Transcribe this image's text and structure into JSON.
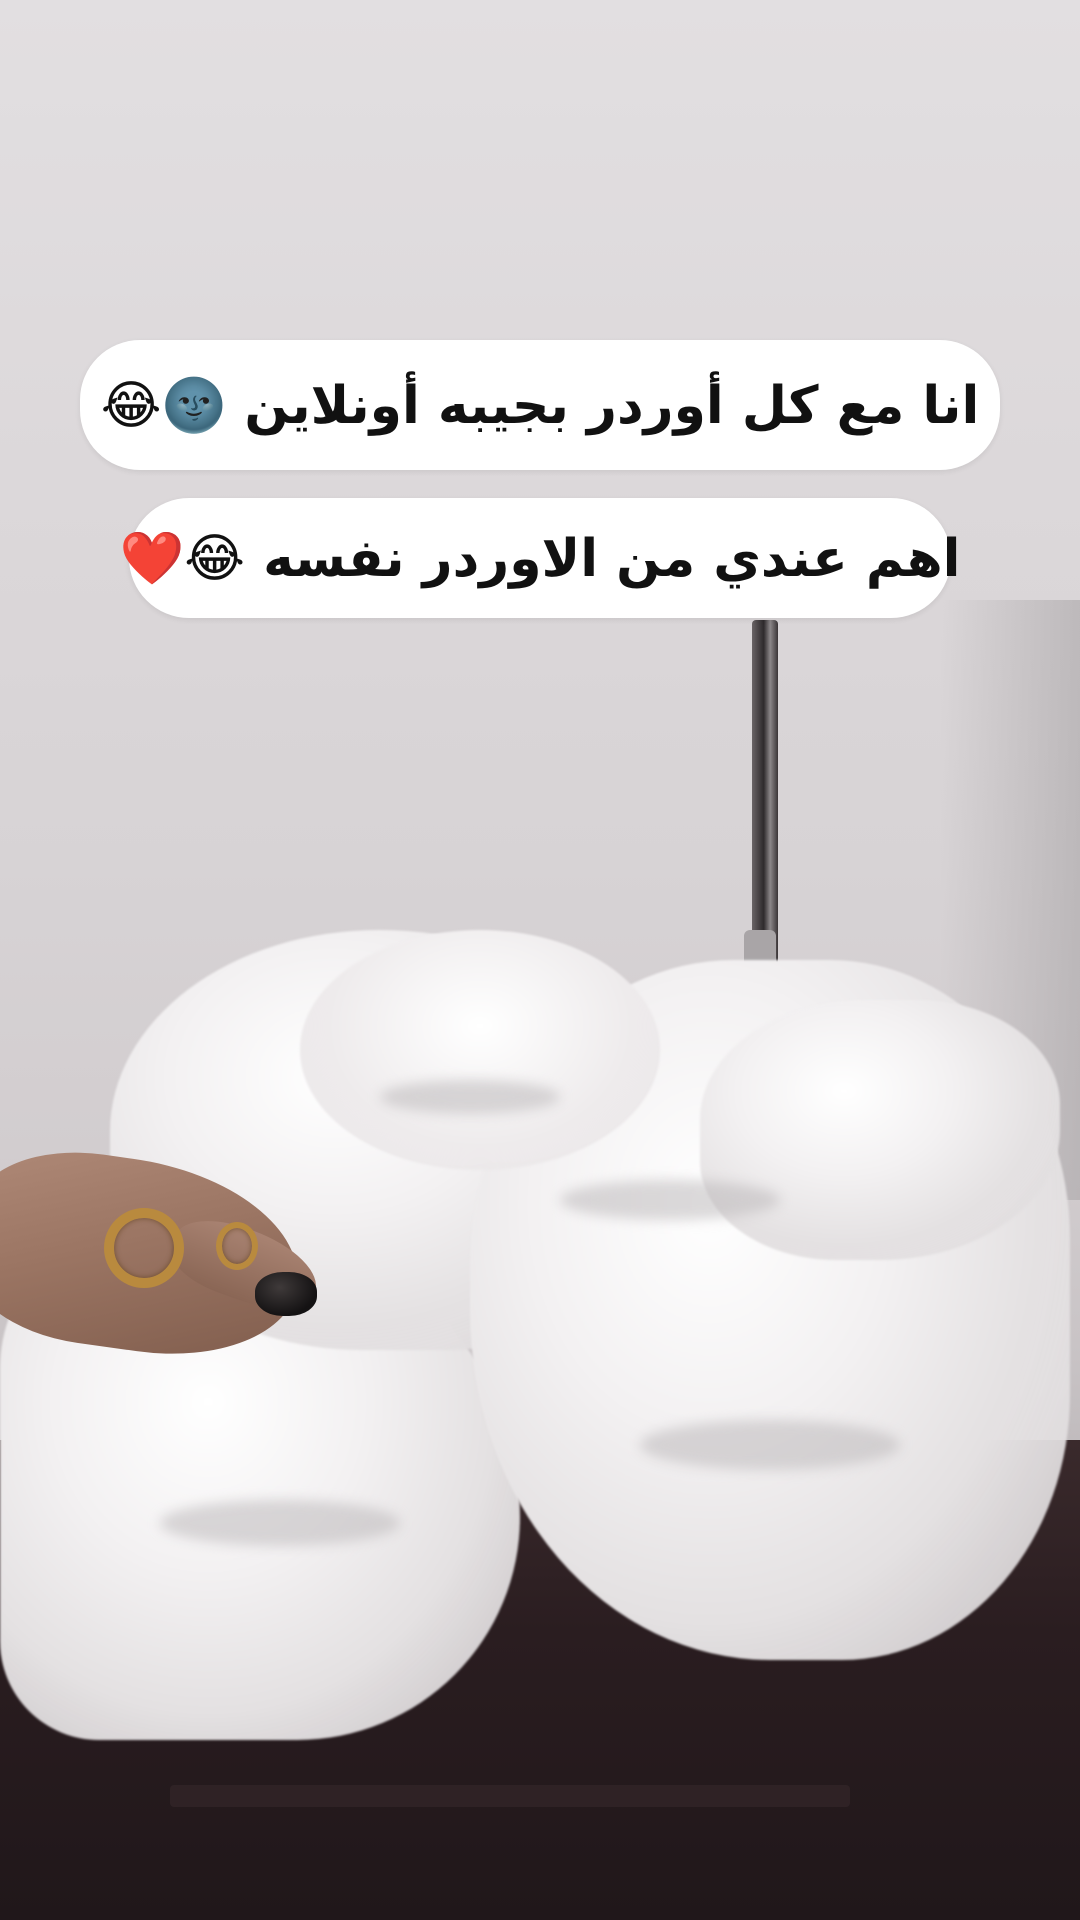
{
  "captions": {
    "line1": "انا مع كل أوردر بجيبه أونلاين 🌚😂",
    "line2": "اهم عندي من الاوردر نفسه 😂❤️"
  }
}
